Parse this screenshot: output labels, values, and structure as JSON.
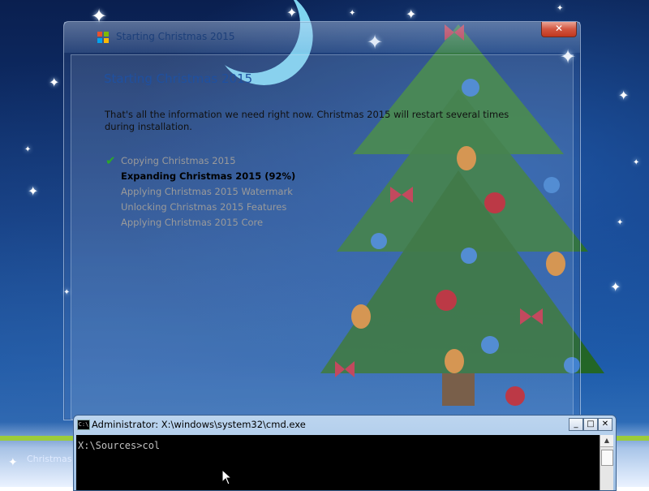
{
  "setup": {
    "window_title": "Starting Christmas 2015",
    "heading": "Starting Christmas 2015",
    "description": "That's all the information we need right now. Christmas 2015 will restart several times during installation.",
    "close_label": "✕",
    "steps": [
      {
        "label": "Copying Christmas 2015",
        "status": "done"
      },
      {
        "label": "Expanding Christmas 2015 (92%)",
        "status": "active"
      },
      {
        "label": "Applying Christmas 2015 Watermark",
        "status": "pending"
      },
      {
        "label": "Unlocking Christmas 2015 Features",
        "status": "pending"
      },
      {
        "label": "Applying Christmas 2015 Core",
        "status": "pending"
      }
    ],
    "checkmark": "✔"
  },
  "cmd": {
    "title": "Administrator: X:\\windows\\system32\\cmd.exe",
    "icon_text": "C:\\",
    "prompt_line": "X:\\Sources>col",
    "min_label": "_",
    "max_label": "□",
    "close_label": "✕"
  },
  "taskbar": {
    "label": "Christmas"
  },
  "colors": {
    "accent": "#1f50a0",
    "check": "#2aa72a",
    "progress": "#9ccc3a"
  }
}
